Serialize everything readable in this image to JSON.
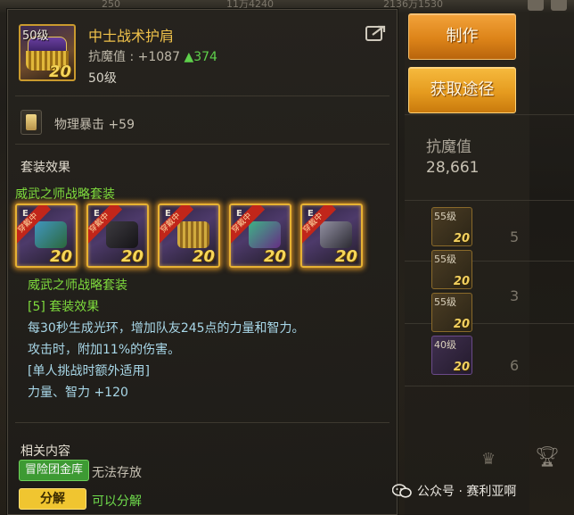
{
  "item": {
    "level_tag": "50级",
    "enhance_badge": "20",
    "name": "中士战术护肩",
    "resist_label": "抗魔值 : +1087",
    "resist_increase": "▲374",
    "required_level": "50级"
  },
  "enchant": {
    "icon": "card-icon",
    "text": "物理暴击 +59"
  },
  "set": {
    "section_title": "套装效果",
    "name": "威武之师战略套装",
    "pieces": [
      {
        "letter": "E",
        "status": "穿戴中",
        "badge": "20",
        "art_color": "#3fa0c8",
        "icon": "armor-top-icon"
      },
      {
        "letter": "E",
        "status": "穿戴中",
        "badge": "20",
        "art_color": "#222222",
        "icon": "pants-icon"
      },
      {
        "letter": "E",
        "status": "穿戴中",
        "badge": "20",
        "art_color": "#d1a630",
        "icon": "shoulder-icon"
      },
      {
        "letter": "E",
        "status": "穿戴中",
        "badge": "20",
        "art_color": "#3cbf8a",
        "icon": "belt-icon"
      },
      {
        "letter": "E",
        "status": "穿戴中",
        "badge": "20",
        "art_color": "#9a9aa8",
        "icon": "boots-icon"
      }
    ],
    "name_repeat": "威武之师战略套装",
    "effect_title": "[5] 套装效果",
    "effect_lines": [
      "每30秒生成光环，增加队友245点的力量和智力。",
      "攻击时，附加11%的伤害。"
    ],
    "solo_note": "[单人挑战时额外适用]",
    "stat_bonus": "力量、智力 +120"
  },
  "related": {
    "section_title": "相关内容",
    "storage_tag": "冒险团金库",
    "storage_value": "无法存放",
    "disassemble_tag": "分解",
    "disassemble_value": "可以分解"
  },
  "actions": {
    "craft_label": "制作",
    "acquire_label": "获取途径"
  },
  "background": {
    "top_text_1": "250",
    "top_text_2": "11万4240",
    "top_text_3": "2136万1530",
    "stat_label": "抗魔值",
    "stat_value": "28,661",
    "edge_digits": [
      "5",
      "3",
      "6"
    ],
    "mini_slots": [
      {
        "level": "55级",
        "badge": "20"
      },
      {
        "level": "55级",
        "badge": "20"
      },
      {
        "level": "55级",
        "badge": "20"
      },
      {
        "level": "40级",
        "badge": "20"
      }
    ]
  },
  "watermark": {
    "text": "公众号 · 赛利亚啊"
  },
  "colors": {
    "item_name": "#f0c24b",
    "set_green": "#7fdc3d",
    "effect_blue": "#a8d7e8",
    "action_orange": "#dd8419",
    "storage_green": "#3d9a33",
    "disassemble_yellow": "#f0c530"
  }
}
